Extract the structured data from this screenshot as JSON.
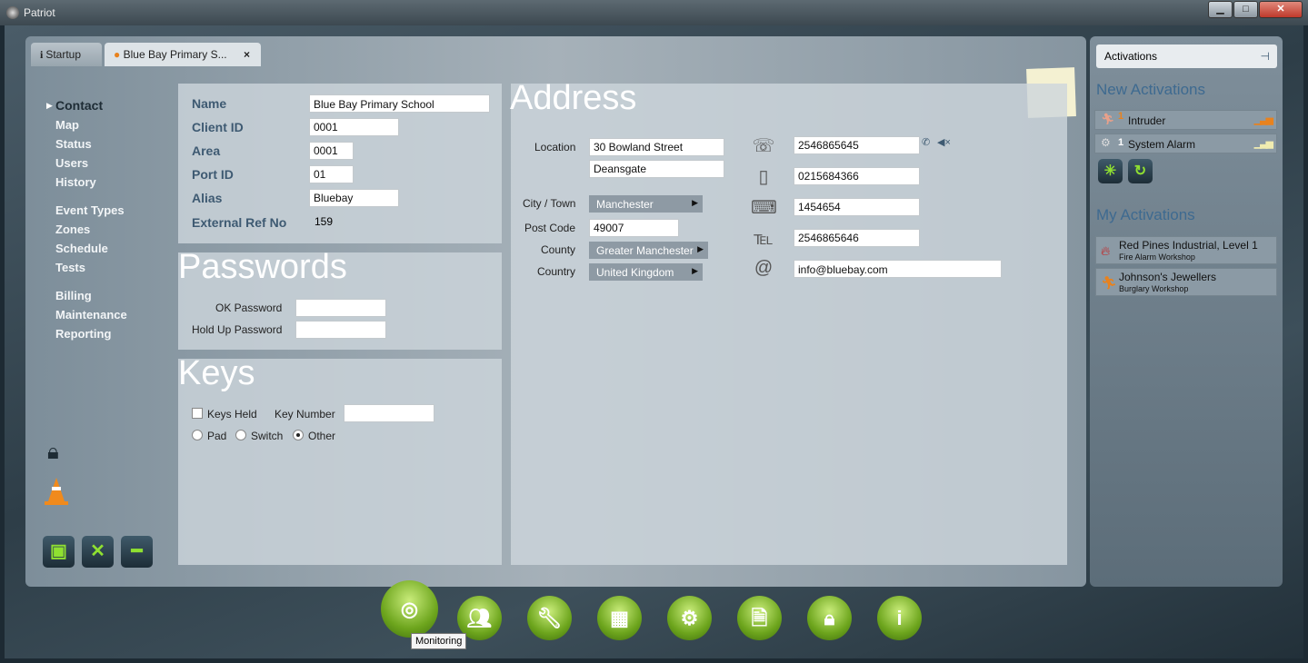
{
  "window": {
    "title": "Patriot",
    "minimize": "▁",
    "maximize": "□",
    "close": "✕"
  },
  "tabs": [
    {
      "label": "Startup",
      "icon": "info-icon"
    },
    {
      "label": "Blue Bay Primary S...",
      "icon": "people-icon",
      "close": "×"
    }
  ],
  "nav": [
    "Contact",
    "Map",
    "Status",
    "Users",
    "History",
    "Event Types",
    "Zones",
    "Schedule",
    "Tests",
    "Billing",
    "Maintenance",
    "Reporting"
  ],
  "contact": {
    "fields": [
      {
        "label": "Name",
        "value": "Blue Bay Primary School"
      },
      {
        "label": "Client ID",
        "value": "0001"
      },
      {
        "label": "Area",
        "value": "0001"
      },
      {
        "label": "Port ID",
        "value": "01"
      },
      {
        "label": "Alias",
        "value": "Bluebay"
      }
    ],
    "ext_label": "External Ref No",
    "ext_value": "159"
  },
  "passwords": {
    "title": "Passwords",
    "ok_label": "OK Password",
    "ok_value": "",
    "holdup_label": "Hold Up Password",
    "holdup_value": ""
  },
  "keys": {
    "title": "Keys",
    "held_label": "Keys Held",
    "held_checked": false,
    "number_label": "Key Number",
    "number_value": "",
    "options": [
      "Pad",
      "Switch",
      "Other"
    ],
    "selected": "Other"
  },
  "address": {
    "title": "Address",
    "location_label": "Location",
    "line1": "30 Bowland Street",
    "line2": "Deansgate",
    "city_label": "City / Town",
    "city": "Manchester",
    "post_label": "Post Code",
    "post": "49007",
    "county_label": "County",
    "county": "Greater Manchester",
    "country_label": "Country",
    "country": "United Kingdom",
    "phones": [
      {
        "icon": "landline-phone-icon",
        "value": "2546865645"
      },
      {
        "icon": "mobile-phone-icon",
        "value": "0215684366"
      },
      {
        "icon": "pager-icon",
        "value": "1454654"
      },
      {
        "icon": "fax-icon",
        "value": "2546865646"
      },
      {
        "icon": "email-at-icon",
        "value": "info@bluebay.com"
      }
    ]
  },
  "activations": {
    "header": "Activations",
    "new_title": "New Activations",
    "new": [
      {
        "label": "Intruder",
        "count": "1",
        "icon": "intruder-icon",
        "color": "#e8821e"
      },
      {
        "label": "System Alarm",
        "count": "1",
        "icon": "gears-icon",
        "color": "#f0ecb0"
      }
    ],
    "my_title": "My Activations",
    "my": [
      {
        "title": "Red Pines Industrial, Level 1",
        "sub": "Fire Alarm Workshop",
        "icon": "fire-icon"
      },
      {
        "title": "Johnson's Jewellers",
        "sub": "Burglary Workshop",
        "icon": "intruder-icon"
      }
    ]
  },
  "toolbar": {
    "buttons": [
      "monitoring",
      "clients",
      "maintenance",
      "calculator",
      "settings",
      "reports",
      "lock",
      "info"
    ],
    "tooltip": "Monitoring"
  }
}
